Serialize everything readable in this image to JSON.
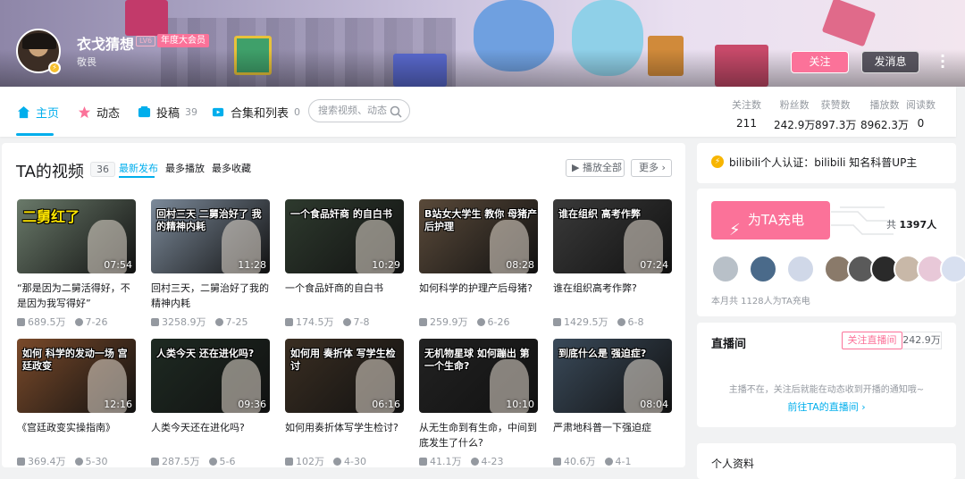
{
  "header": {
    "username": "衣戈猜想",
    "level": "LV6",
    "vip_label": "年度大会员",
    "signature": "敬畏",
    "follow_label": "关注",
    "message_label": "发消息"
  },
  "nav": {
    "items": [
      {
        "label": "主页",
        "count": ""
      },
      {
        "label": "动态",
        "count": ""
      },
      {
        "label": "投稿",
        "count": "39"
      },
      {
        "label": "合集和列表",
        "count": "0"
      }
    ],
    "search_placeholder": "搜索视频、动态"
  },
  "stats": [
    {
      "label": "关注数",
      "value": "211"
    },
    {
      "label": "粉丝数",
      "value": "242.9万"
    },
    {
      "label": "获赞数",
      "value": "897.3万"
    },
    {
      "label": "播放数",
      "value": "8962.3万"
    },
    {
      "label": "阅读数",
      "value": "0"
    }
  ],
  "videos_section": {
    "title": "TA的视频",
    "count": "36",
    "tabs": [
      "最新发布",
      "最多播放",
      "最多收藏"
    ],
    "play_all_label": "播放全部",
    "more_label": "更多"
  },
  "videos": [
    {
      "thumb_text": "二舅红了",
      "duration": "07:54",
      "title": "“那是因为二舅活得好，不是因为我写得好”",
      "views": "689.5万",
      "date": "7-26",
      "bg": "#6a7a6a"
    },
    {
      "thumb_text": "回村三天 二舅治好了 我的精神内耗",
      "duration": "11:28",
      "title": "回村三天，二舅治好了我的精神内耗",
      "views": "3258.9万",
      "date": "7-25",
      "bg": "#7c8a9a"
    },
    {
      "thumb_text": "一个食品奸商 的自白书",
      "duration": "10:29",
      "title": "一个食品奸商的自白书",
      "views": "174.5万",
      "date": "7-8",
      "bg": "#2e3a2e"
    },
    {
      "thumb_text": "B站女大学生 教你 母猪产后护理",
      "duration": "08:28",
      "title": "如何科学的护理产后母猪?",
      "views": "259.9万",
      "date": "6-26",
      "bg": "#5a4a3a"
    },
    {
      "thumb_text": "谁在组织 高考作弊",
      "duration": "07:24",
      "title": "谁在组织高考作弊?",
      "views": "1429.5万",
      "date": "6-8",
      "bg": "#3a3a3a"
    },
    {
      "thumb_text": "如何 科学的发动一场 宫廷政变",
      "duration": "12:16",
      "title": "《宫廷政变实操指南》",
      "views": "369.4万",
      "date": "5-30",
      "bg": "#7a4a2a"
    },
    {
      "thumb_text": "人类今天 还在进化吗?",
      "duration": "09:36",
      "title": "人类今天还在进化吗?",
      "views": "287.5万",
      "date": "5-6",
      "bg": "#1e2a22"
    },
    {
      "thumb_text": "如何用 奏折体 写学生检讨",
      "duration": "06:16",
      "title": "如何用奏折体写学生检讨?",
      "views": "102万",
      "date": "4-30",
      "bg": "#3a2e22"
    },
    {
      "thumb_text": "无机物星球 如何蹦出 第一个生命?",
      "duration": "10:10",
      "title": "从无生命到有生命，中间到底发生了什么?",
      "views": "41.1万",
      "date": "4-23",
      "bg": "#222222"
    },
    {
      "thumb_text": "到底什么是 强迫症?",
      "duration": "08:04",
      "title": "严肃地科普一下强迫症",
      "views": "40.6万",
      "date": "4-1",
      "bg": "#3a4a5a"
    }
  ],
  "sidebar": {
    "cert_text": "bilibili个人认证：bilibili 知名科普UP主",
    "charge_label": "为TA充电",
    "charge_total_prefix": "共",
    "charge_total": "1397人",
    "charge_month": "本月共 1128人为TA充电",
    "live_title": "直播间",
    "live_follow_label": "关注直播间",
    "live_follow_count": "242.9万",
    "live_hint": "主播不在，关注后就能在动态收到开播的通知哦~",
    "live_go": "前往TA的直播间",
    "profile_title": "个人资料"
  },
  "colors": {
    "accent": "#00aeec",
    "pink": "#fb7299"
  }
}
